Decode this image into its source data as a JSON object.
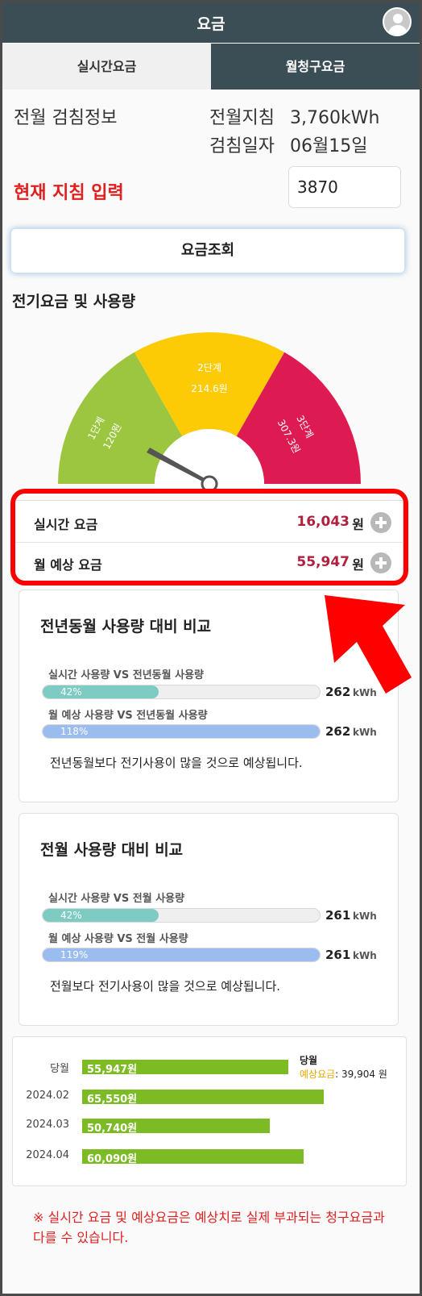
{
  "header": {
    "title": "요금"
  },
  "tabs": {
    "realtime": "실시간요금",
    "monthly": "월청구요금"
  },
  "prev_reading": {
    "section_label": "전월 검침정보",
    "meter_label": "전월지침",
    "meter_value": "3,760kWh",
    "date_label": "검침일자",
    "date_value": "06월15일"
  },
  "current_input": {
    "label": "현재 지침 입력",
    "value": "3870"
  },
  "query_button": "요금조회",
  "usage_section": {
    "title": "전기요금 및 사용량"
  },
  "gauge": {
    "stages": [
      {
        "name": "1단계",
        "price": "120원",
        "color": "#9cc63f"
      },
      {
        "name": "2단계",
        "price": "214.6원",
        "color": "#fccb06"
      },
      {
        "name": "3단계",
        "price": "307.3원",
        "color": "#dd1a52"
      }
    ]
  },
  "summary": {
    "realtime_label": "실시간 요금",
    "realtime_value": "16,043",
    "monthly_label": "월 예상 요금",
    "monthly_value": "55,947",
    "currency": "원"
  },
  "yoy_card": {
    "title": "전년동월 사용량 대비 비교",
    "bar1": {
      "label": "실시간 사용량 VS 전년동월 사용량",
      "percent": 42,
      "percent_text": "42%",
      "value": "262",
      "unit": "kWh"
    },
    "bar2": {
      "label": "월 예상 사용량 VS 전년동월 사용량",
      "percent": 118,
      "percent_text": "118%",
      "value": "262",
      "unit": "kWh"
    },
    "note": "전년동월보다 전기사용이 많을 것으로 예상됩니다."
  },
  "mom_card": {
    "title": "전월 사용량 대비 비교",
    "bar1": {
      "label": "실시간 사용량 VS 전월 사용량",
      "percent": 42,
      "percent_text": "42%",
      "value": "261",
      "unit": "kWh"
    },
    "bar2": {
      "label": "월 예상 사용량 VS 전월 사용량",
      "percent": 119,
      "percent_text": "119%",
      "value": "261",
      "unit": "kWh"
    },
    "note": "전월보다 전기사용이 많을 것으로 예상됩니다."
  },
  "history": {
    "rows": [
      {
        "label": "당월",
        "value_text": "55,947원",
        "value": 55947
      },
      {
        "label": "2024.02",
        "value_text": "65,550원",
        "value": 65550
      },
      {
        "label": "2024.03",
        "value_text": "50,740원",
        "value": 50740
      },
      {
        "label": "2024.04",
        "value_text": "60,090원",
        "value": 60090
      }
    ],
    "legend_title": "당월",
    "legend_key": "예상요금",
    "legend_value": ": 39,904 원"
  },
  "notice": "※ 실시간 요금 및 예상요금은 예상치로 실제 부과되는 청구요금과 다를 수 있습니다."
}
